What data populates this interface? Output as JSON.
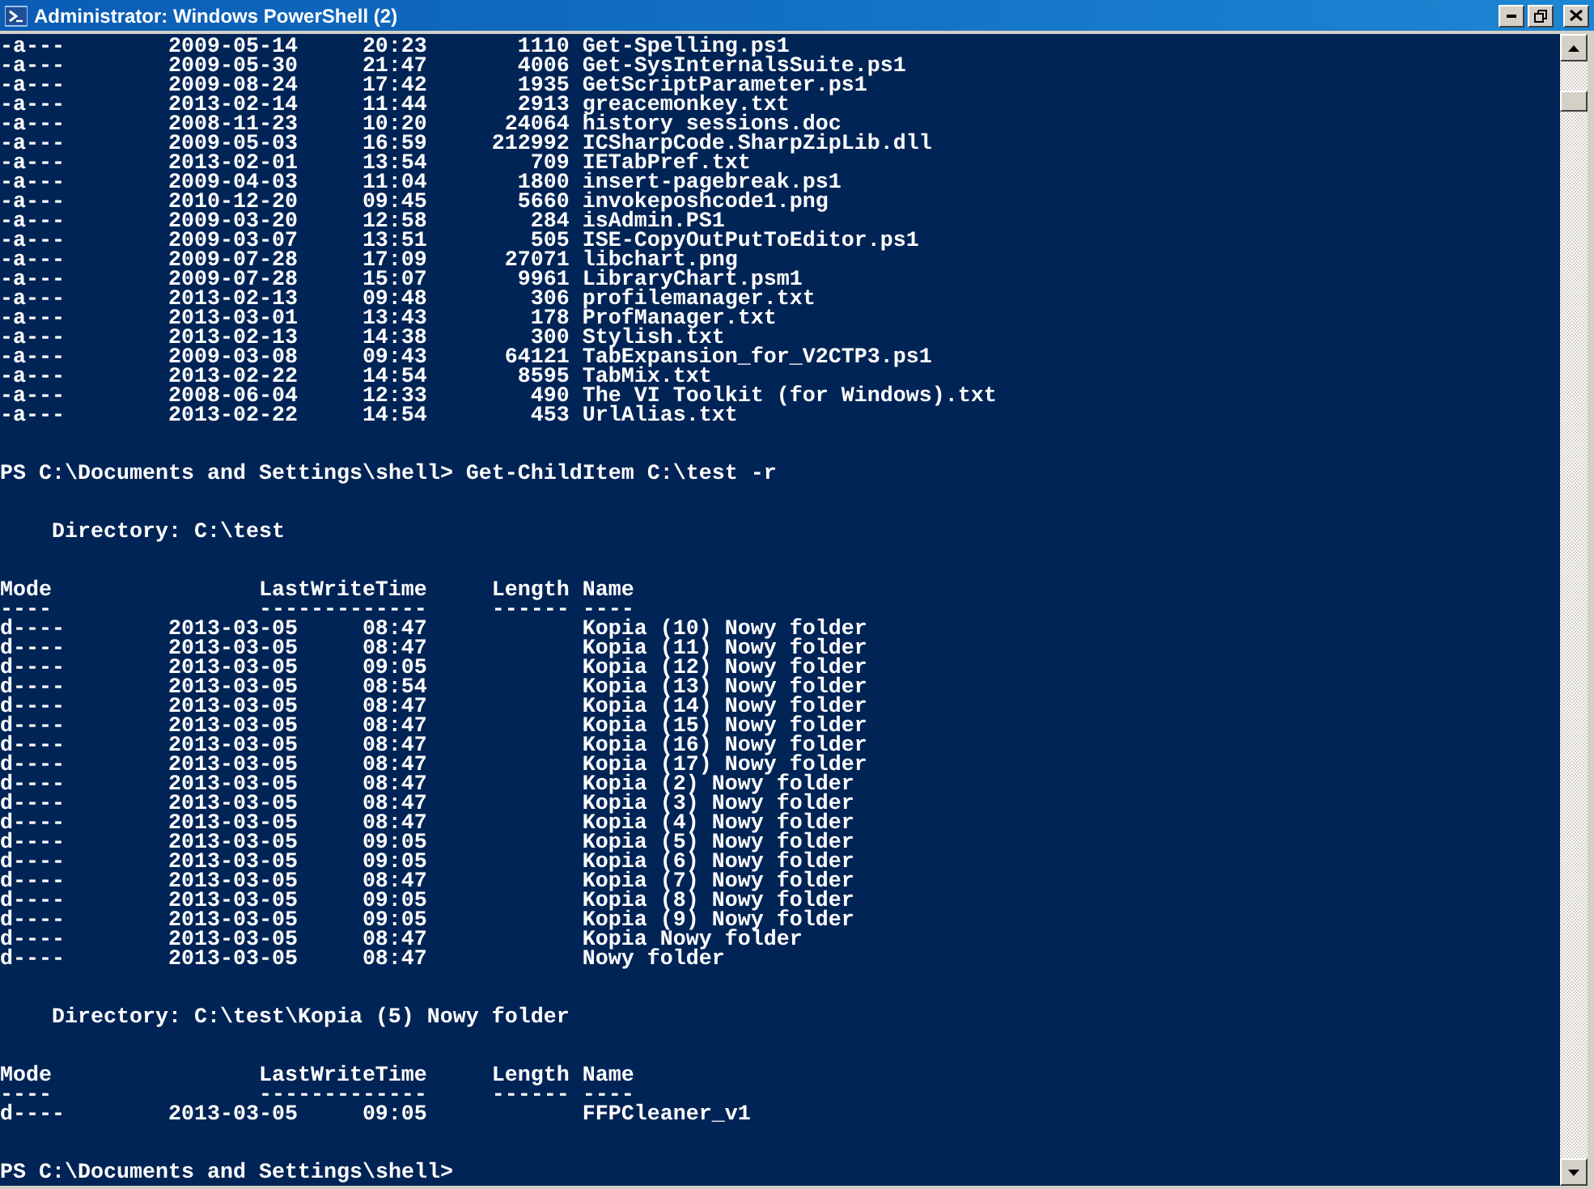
{
  "window": {
    "title": "Administrator: Windows PowerShell (2)"
  },
  "console": [
    {
      "kind": "row",
      "mode": "-a---",
      "date": "2009-05-14",
      "time": "20:23",
      "length": "1110",
      "name": "Get-Spelling.ps1"
    },
    {
      "kind": "row",
      "mode": "-a---",
      "date": "2009-05-30",
      "time": "21:47",
      "length": "4006",
      "name": "Get-SysInternalsSuite.ps1"
    },
    {
      "kind": "row",
      "mode": "-a---",
      "date": "2009-08-24",
      "time": "17:42",
      "length": "1935",
      "name": "GetScriptParameter.ps1"
    },
    {
      "kind": "row",
      "mode": "-a---",
      "date": "2013-02-14",
      "time": "11:44",
      "length": "2913",
      "name": "greacemonkey.txt"
    },
    {
      "kind": "row",
      "mode": "-a---",
      "date": "2008-11-23",
      "time": "10:20",
      "length": "24064",
      "name": "history sessions.doc"
    },
    {
      "kind": "row",
      "mode": "-a---",
      "date": "2009-05-03",
      "time": "16:59",
      "length": "212992",
      "name": "ICSharpCode.SharpZipLib.dll"
    },
    {
      "kind": "row",
      "mode": "-a---",
      "date": "2013-02-01",
      "time": "13:54",
      "length": "709",
      "name": "IETabPref.txt"
    },
    {
      "kind": "row",
      "mode": "-a---",
      "date": "2009-04-03",
      "time": "11:04",
      "length": "1800",
      "name": "insert-pagebreak.ps1"
    },
    {
      "kind": "row",
      "mode": "-a---",
      "date": "2010-12-20",
      "time": "09:45",
      "length": "5660",
      "name": "invokeposhcode1.png"
    },
    {
      "kind": "row",
      "mode": "-a---",
      "date": "2009-03-20",
      "time": "12:58",
      "length": "284",
      "name": "isAdmin.PS1"
    },
    {
      "kind": "row",
      "mode": "-a---",
      "date": "2009-03-07",
      "time": "13:51",
      "length": "505",
      "name": "ISE-CopyOutPutToEditor.ps1"
    },
    {
      "kind": "row",
      "mode": "-a---",
      "date": "2009-07-28",
      "time": "17:09",
      "length": "27071",
      "name": "libchart.png"
    },
    {
      "kind": "row",
      "mode": "-a---",
      "date": "2009-07-28",
      "time": "15:07",
      "length": "9961",
      "name": "LibraryChart.psm1"
    },
    {
      "kind": "row",
      "mode": "-a---",
      "date": "2013-02-13",
      "time": "09:48",
      "length": "306",
      "name": "profilemanager.txt"
    },
    {
      "kind": "row",
      "mode": "-a---",
      "date": "2013-03-01",
      "time": "13:43",
      "length": "178",
      "name": "ProfManager.txt"
    },
    {
      "kind": "row",
      "mode": "-a---",
      "date": "2013-02-13",
      "time": "14:38",
      "length": "300",
      "name": "Stylish.txt"
    },
    {
      "kind": "row",
      "mode": "-a---",
      "date": "2009-03-08",
      "time": "09:43",
      "length": "64121",
      "name": "TabExpansion_for_V2CTP3.ps1"
    },
    {
      "kind": "row",
      "mode": "-a---",
      "date": "2013-02-22",
      "time": "14:54",
      "length": "8595",
      "name": "TabMix.txt"
    },
    {
      "kind": "row",
      "mode": "-a---",
      "date": "2008-06-04",
      "time": "12:33",
      "length": "490",
      "name": "The VI Toolkit (for Windows).txt"
    },
    {
      "kind": "row",
      "mode": "-a---",
      "date": "2013-02-22",
      "time": "14:54",
      "length": "453",
      "name": "UrlAlias.txt"
    },
    {
      "kind": "blank"
    },
    {
      "kind": "blank"
    },
    {
      "kind": "prompt",
      "prompt": "PS C:\\Documents and Settings\\shell>",
      "command": "Get-ChildItem C:\\test -r"
    },
    {
      "kind": "blank"
    },
    {
      "kind": "blank"
    },
    {
      "kind": "directory",
      "text": "Directory: C:\\test"
    },
    {
      "kind": "blank"
    },
    {
      "kind": "blank"
    },
    {
      "kind": "header",
      "columns": [
        "Mode",
        "LastWriteTime",
        "Length",
        "Name"
      ]
    },
    {
      "kind": "rule",
      "columns": [
        "----",
        "-------------",
        "------",
        "----"
      ]
    },
    {
      "kind": "row",
      "mode": "d----",
      "date": "2013-03-05",
      "time": "08:47",
      "name": "Kopia (10) Nowy folder"
    },
    {
      "kind": "row",
      "mode": "d----",
      "date": "2013-03-05",
      "time": "08:47",
      "name": "Kopia (11) Nowy folder"
    },
    {
      "kind": "row",
      "mode": "d----",
      "date": "2013-03-05",
      "time": "09:05",
      "name": "Kopia (12) Nowy folder"
    },
    {
      "kind": "row",
      "mode": "d----",
      "date": "2013-03-05",
      "time": "08:54",
      "name": "Kopia (13) Nowy folder"
    },
    {
      "kind": "row",
      "mode": "d----",
      "date": "2013-03-05",
      "time": "08:47",
      "name": "Kopia (14) Nowy folder"
    },
    {
      "kind": "row",
      "mode": "d----",
      "date": "2013-03-05",
      "time": "08:47",
      "name": "Kopia (15) Nowy folder"
    },
    {
      "kind": "row",
      "mode": "d----",
      "date": "2013-03-05",
      "time": "08:47",
      "name": "Kopia (16) Nowy folder"
    },
    {
      "kind": "row",
      "mode": "d----",
      "date": "2013-03-05",
      "time": "08:47",
      "name": "Kopia (17) Nowy folder"
    },
    {
      "kind": "row",
      "mode": "d----",
      "date": "2013-03-05",
      "time": "08:47",
      "name": "Kopia (2) Nowy folder"
    },
    {
      "kind": "row",
      "mode": "d----",
      "date": "2013-03-05",
      "time": "08:47",
      "name": "Kopia (3) Nowy folder"
    },
    {
      "kind": "row",
      "mode": "d----",
      "date": "2013-03-05",
      "time": "08:47",
      "name": "Kopia (4) Nowy folder"
    },
    {
      "kind": "row",
      "mode": "d----",
      "date": "2013-03-05",
      "time": "09:05",
      "name": "Kopia (5) Nowy folder"
    },
    {
      "kind": "row",
      "mode": "d----",
      "date": "2013-03-05",
      "time": "09:05",
      "name": "Kopia (6) Nowy folder"
    },
    {
      "kind": "row",
      "mode": "d----",
      "date": "2013-03-05",
      "time": "08:47",
      "name": "Kopia (7) Nowy folder"
    },
    {
      "kind": "row",
      "mode": "d----",
      "date": "2013-03-05",
      "time": "09:05",
      "name": "Kopia (8) Nowy folder"
    },
    {
      "kind": "row",
      "mode": "d----",
      "date": "2013-03-05",
      "time": "09:05",
      "name": "Kopia (9) Nowy folder"
    },
    {
      "kind": "row",
      "mode": "d----",
      "date": "2013-03-05",
      "time": "08:47",
      "name": "Kopia Nowy folder"
    },
    {
      "kind": "row",
      "mode": "d----",
      "date": "2013-03-05",
      "time": "08:47",
      "name": "Nowy folder"
    },
    {
      "kind": "blank"
    },
    {
      "kind": "blank"
    },
    {
      "kind": "directory",
      "text": "Directory: C:\\test\\Kopia (5) Nowy folder"
    },
    {
      "kind": "blank"
    },
    {
      "kind": "blank"
    },
    {
      "kind": "header",
      "columns": [
        "Mode",
        "LastWriteTime",
        "Length",
        "Name"
      ]
    },
    {
      "kind": "rule",
      "columns": [
        "----",
        "-------------",
        "------",
        "----"
      ]
    },
    {
      "kind": "row",
      "mode": "d----",
      "date": "2013-03-05",
      "time": "09:05",
      "name": "FFPCleaner_v1"
    },
    {
      "kind": "blank"
    },
    {
      "kind": "blank"
    },
    {
      "kind": "prompt",
      "prompt": "PS C:\\Documents and Settings\\shell>"
    }
  ]
}
